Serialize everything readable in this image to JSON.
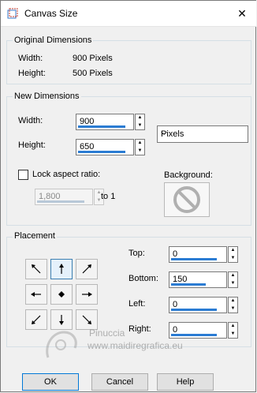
{
  "window": {
    "title": "Canvas Size",
    "close_glyph": "✕"
  },
  "original": {
    "group_title": "Original Dimensions",
    "width_label": "Width:",
    "width_value": "900 Pixels",
    "height_label": "Height:",
    "height_value": "500 Pixels"
  },
  "new_dims": {
    "group_title": "New Dimensions",
    "width_label": "Width:",
    "width_value": "900",
    "height_label": "Height:",
    "height_value": "650",
    "units_selected": "Pixels",
    "lock_label": "Lock aspect ratio:",
    "lock_checked": false,
    "ratio_value": "1,800",
    "ratio_suffix": "to 1",
    "background_label": "Background:"
  },
  "placement": {
    "group_title": "Placement",
    "top_label": "Top:",
    "top_value": "0",
    "bottom_label": "Bottom:",
    "bottom_value": "150",
    "left_label": "Left:",
    "left_value": "0",
    "right_label": "Right:",
    "right_value": "0",
    "selected_anchor": "top-center"
  },
  "buttons": {
    "ok": "OK",
    "cancel": "Cancel",
    "help": "Help"
  },
  "watermark": {
    "name": "Pinuccia",
    "url": "www.maidiregrafica.eu"
  },
  "colors": {
    "accent": "#2b7cd3",
    "selected_border": "#3c7fb1"
  },
  "icons": {
    "app": "canvas-size-icon",
    "background": "no-color-icon",
    "units": "chevron-down-icon"
  }
}
